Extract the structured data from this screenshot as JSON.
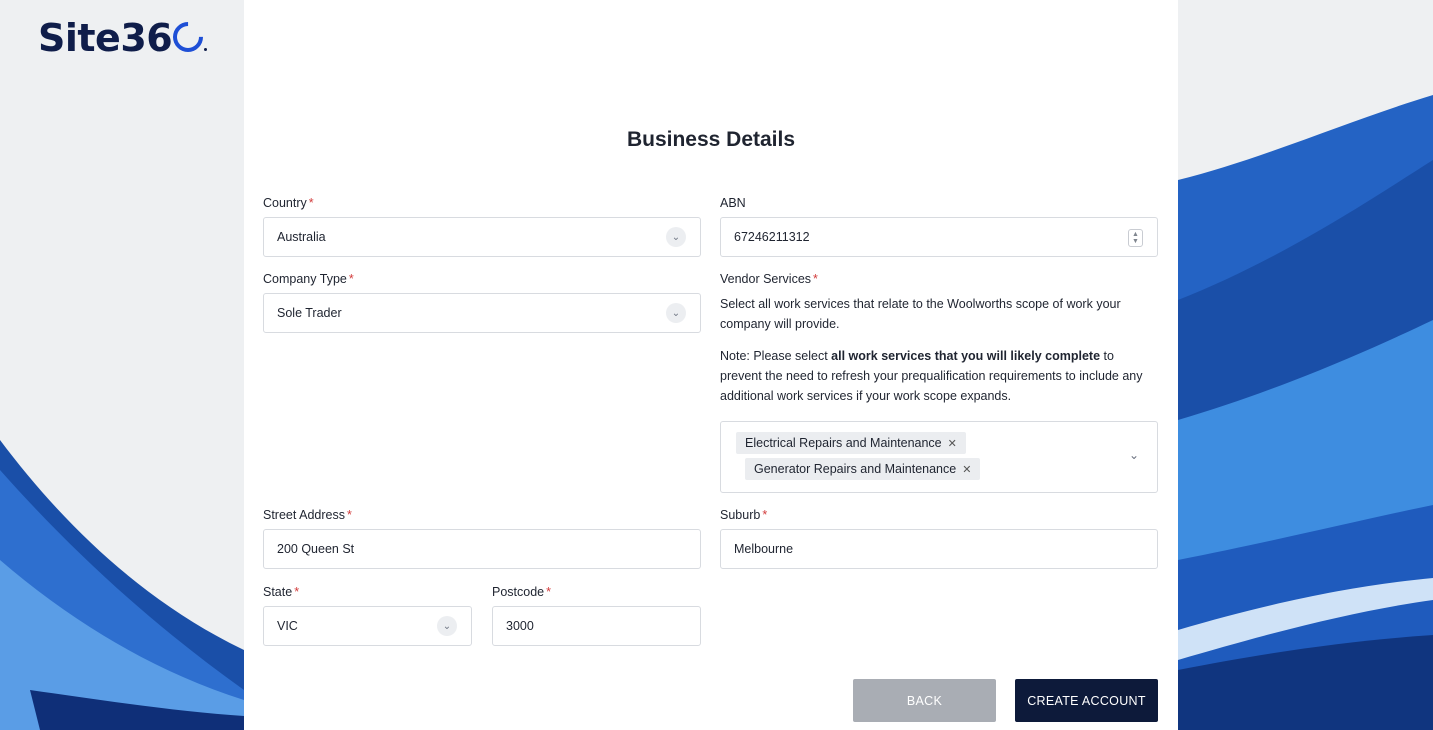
{
  "brand": {
    "logo_text": "Site36"
  },
  "page": {
    "title": "Business Details"
  },
  "form": {
    "country": {
      "label": "Country",
      "value": "Australia"
    },
    "abn": {
      "label": "ABN",
      "value": "67246211312"
    },
    "company_type": {
      "label": "Company Type",
      "value": "Sole Trader"
    },
    "vendor_services": {
      "label": "Vendor Services",
      "help": "Select all work services that relate to the Woolworths scope of work your company will provide.",
      "note_prefix": "Note: Please select ",
      "note_bold": "all work services that you will likely complete",
      "note_suffix": " to prevent the need to refresh your prequalification requirements to include any additional work services if your work scope expands.",
      "selected": [
        "Electrical Repairs and Maintenance",
        "Generator Repairs and Maintenance"
      ]
    },
    "street_address": {
      "label": "Street Address",
      "value": "200 Queen St"
    },
    "suburb": {
      "label": "Suburb",
      "value": "Melbourne"
    },
    "state": {
      "label": "State",
      "value": "VIC"
    },
    "postcode": {
      "label": "Postcode",
      "value": "3000"
    }
  },
  "actions": {
    "back_label": "BACK",
    "create_label": "CREATE ACCOUNT"
  },
  "colors": {
    "brand_navy": "#0d1a3a",
    "accent_blue": "#1e4fd6",
    "required": "#d23b3b",
    "back_button": "#a9adb4"
  },
  "icons": {
    "select": "chevron-down-icon",
    "chip_remove": "close-icon",
    "number": "spinner-icon"
  }
}
